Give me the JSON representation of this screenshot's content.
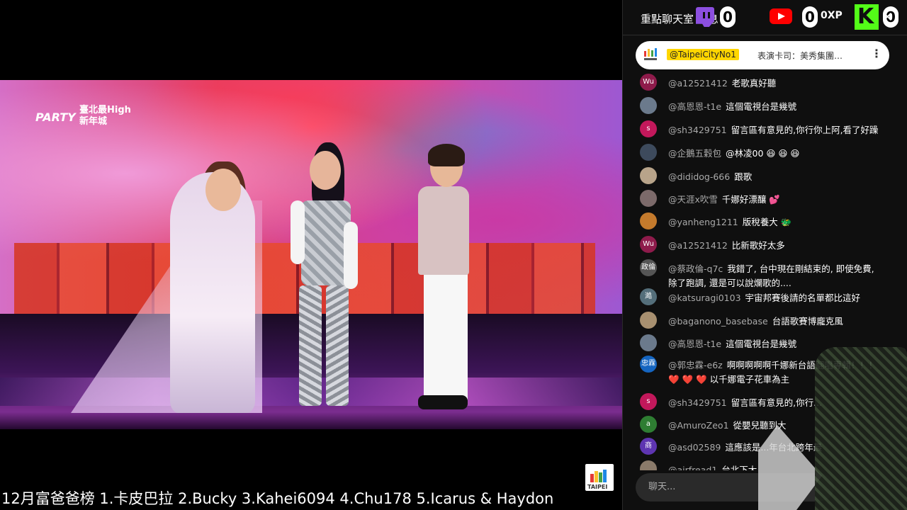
{
  "chat": {
    "title": "重點聊天室 訊息",
    "badges": {
      "twitch_count": "0",
      "youtube_count": "0",
      "xp_label": "0XP",
      "kick_count": "0",
      "kick_letter": "K"
    },
    "close_icon": "close-icon",
    "pinned": {
      "user": "@TaipeiCityNo1",
      "text": "表演卡司：美秀集團…",
      "more": "⋮"
    },
    "messages": [
      {
        "avatar": "Wu",
        "avatar_color": "#8e1b4b",
        "user": "@a12521412",
        "text": "老歌真好聽"
      },
      {
        "avatar": "",
        "avatar_color": "#6b7a8c",
        "user": "@高恩恩-t1e",
        "text": "這個電視台是幾號"
      },
      {
        "avatar": "s",
        "avatar_color": "#c2185b",
        "user": "@sh3429751",
        "text": "留言區有意見的,你行你上阿,看了好躁"
      },
      {
        "avatar": "",
        "avatar_color": "#3d4a5c",
        "user": "@企鵝五穀包",
        "text": "@林凌00 😆 😆 😆"
      },
      {
        "avatar": "",
        "avatar_color": "#b8a48a",
        "user": "@dididog-666",
        "text": "跟歌"
      },
      {
        "avatar": "",
        "avatar_color": "#7c6a6a",
        "user": "@天涯x吹雪",
        "text": "千娜好漂釀 💕"
      },
      {
        "avatar": "",
        "avatar_color": "#c47a2c",
        "user": "@yanheng1211",
        "text": "版稅養大 🐲"
      },
      {
        "avatar": "Wu",
        "avatar_color": "#8e1b4b",
        "user": "@a12521412",
        "text": "比新歌好太多"
      },
      {
        "avatar": "政倫",
        "avatar_color": "#555555",
        "user": "@蔡政倫-q7c",
        "text": "我錯了, 台中現在剛結束的, 即使免費, 除了跑調, 還是可以說爛歌的...."
      },
      {
        "avatar": "澔",
        "avatar_color": "#546e7a",
        "user": "@katsuragi0103",
        "text": "宇宙邦賽後請的名單都比這好"
      },
      {
        "avatar": "",
        "avatar_color": "#a89070",
        "user": "@baganono_basebase",
        "text": "台語歌賽博龐克風"
      },
      {
        "avatar": "",
        "avatar_color": "#6b7a8c",
        "user": "@高恩恩-t1e",
        "text": "這個電視台是幾號"
      },
      {
        "avatar": "忠霖",
        "avatar_color": "#1565c0",
        "user": "@郭忠霖-e6z",
        "text": "啊啊啊啊啊千娜新台語翻唱專輯！！！❤️ ❤️ ❤️ 以千娜電子花車為主"
      },
      {
        "avatar": "s",
        "avatar_color": "#c2185b",
        "user": "@sh3429751",
        "text": "留言區有意見的,你行..."
      },
      {
        "avatar": "a",
        "avatar_color": "#2e7d32",
        "user": "@AmuroZeo1",
        "text": "從嬰兒聽到大"
      },
      {
        "avatar": "商",
        "avatar_color": "#5e35b1",
        "user": "@asd02589",
        "text": "這應該是...年台北跨年最"
      },
      {
        "avatar": "",
        "avatar_color": "#8a7a6a",
        "user": "@airfread1",
        "text": "台北下大..."
      }
    ],
    "input_placeholder": "聊天..."
  },
  "video": {
    "logo_party": "PARTY",
    "logo_zh": "臺北最High 新年城"
  },
  "ticker": {
    "text": "12月富爸爸榜   1.卡皮巴拉 2.Bucky 3.Kahei6094 4.Chu178 5.Icarus & Haydon"
  },
  "taipei_logo": {
    "text": "TAIPEI"
  }
}
